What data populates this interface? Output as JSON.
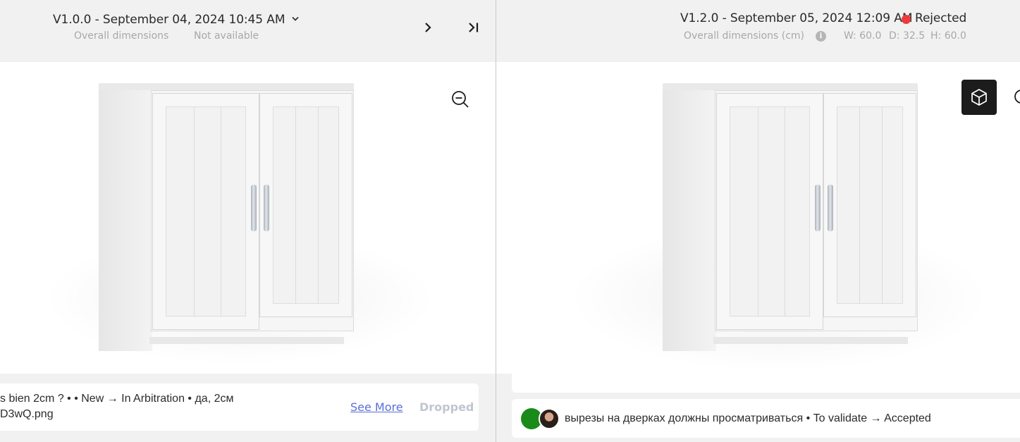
{
  "left": {
    "version_title": "V1.0.0 - September 04, 2024 10:45 AM",
    "dimensions_label": "Overall dimensions",
    "dimensions_value": "Not available",
    "comment": {
      "line1": "s bien 2cm ? • • New → In Arbitration • да, 2см",
      "line2": "D3wQ.png",
      "see_more": "See More",
      "status": "Dropped"
    }
  },
  "right": {
    "version_title": "V1.2.0 - September 05, 2024 12:09 AM",
    "status_label": "Rejected",
    "status_color": "#ee3a3a",
    "dimensions_label": "Overall dimensions (cm)",
    "info_icon": "i",
    "width": "W: 60.0",
    "depth": "D: 32.5",
    "height": "H: 60.0",
    "comment": {
      "text": "вырезы на дверках должны просматриваться • To validate → Accepted"
    }
  },
  "colors": {
    "header_bg": "#f1f1f1",
    "viewer_bg": "#ffffff",
    "link": "#5a6fd6",
    "dropped": "#c0c6d0",
    "avatar_green": "#1a8a1a"
  },
  "icons": [
    "chevron-down-icon",
    "chevron-right-icon",
    "skip-to-last-icon",
    "zoom-out-icon",
    "cube-3d-icon",
    "info-icon",
    "zoom-icon"
  ]
}
